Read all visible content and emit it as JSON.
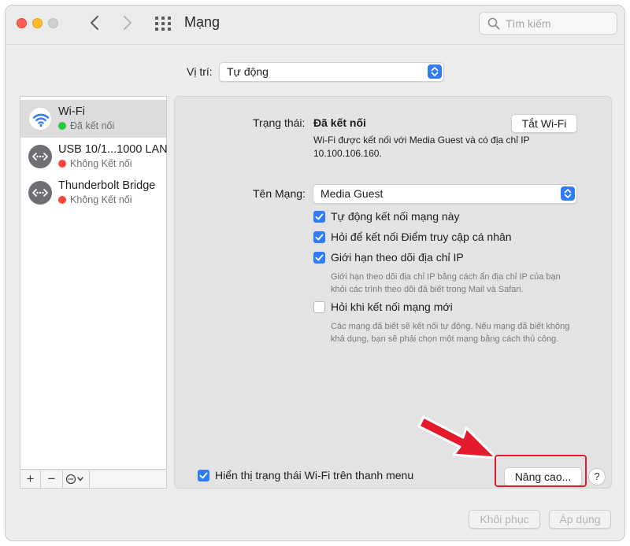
{
  "window": {
    "title": "Mạng",
    "search_placeholder": "Tìm kiếm"
  },
  "location": {
    "label": "Vị trí:",
    "value": "Tự động"
  },
  "services": [
    {
      "name": "Wi-Fi",
      "status": "Đã kết nối",
      "status_color": "#28c940",
      "icon": "wifi-icon",
      "selected": true
    },
    {
      "name": "USB 10/1...1000 LAN",
      "status": "Không Kết nối",
      "status_color": "#ff453a",
      "icon": "ethernet-icon",
      "selected": false
    },
    {
      "name": "Thunderbolt Bridge",
      "status": "Không Kết nối",
      "status_color": "#ff453a",
      "icon": "ethernet-icon",
      "selected": false
    }
  ],
  "sidebar_toolbar": {
    "add": "+",
    "remove": "−"
  },
  "detail": {
    "status_label": "Trạng thái:",
    "status_value": "Đã kết nối",
    "turn_off_button": "Tắt Wi-Fi",
    "status_desc_line1": "Wi-Fi được kết nối với Media Guest và có địa chỉ IP",
    "status_desc_line2": "10.100.106.160.",
    "network_label": "Tên Mạng:",
    "network_value": "Media Guest",
    "options": [
      {
        "label": "Tự động kết nối mạng này",
        "checked": true
      },
      {
        "label": "Hỏi để kết nối Điểm truy cập cá nhân",
        "checked": true
      },
      {
        "label": "Giới hạn theo dõi địa chỉ IP",
        "checked": true
      },
      {
        "label": "Hỏi khi kết nối mạng mới",
        "checked": false
      }
    ],
    "limit_note_line1": "Giới hạn theo dõi địa chỉ IP bằng cách ẩn địa chỉ IP của bạn",
    "limit_note_line2": "khỏi các trình theo dõi đã biết trong Mail và Safari.",
    "ask_note_line1": "Các mạng đã biết sẽ kết nối tự động. Nếu mạng đã biết không",
    "ask_note_line2": "khả dụng, bạn sẽ phải chọn một mạng bằng cách thủ công.",
    "show_status_label": "Hiển thị trạng thái Wi-Fi trên thanh menu",
    "show_status_checked": true,
    "advanced_button": "Nâng cao...",
    "help": "?"
  },
  "footer": {
    "revert_button": "Khôi phục",
    "apply_button": "Áp dụng"
  },
  "annotation_color": "#e41b2c"
}
